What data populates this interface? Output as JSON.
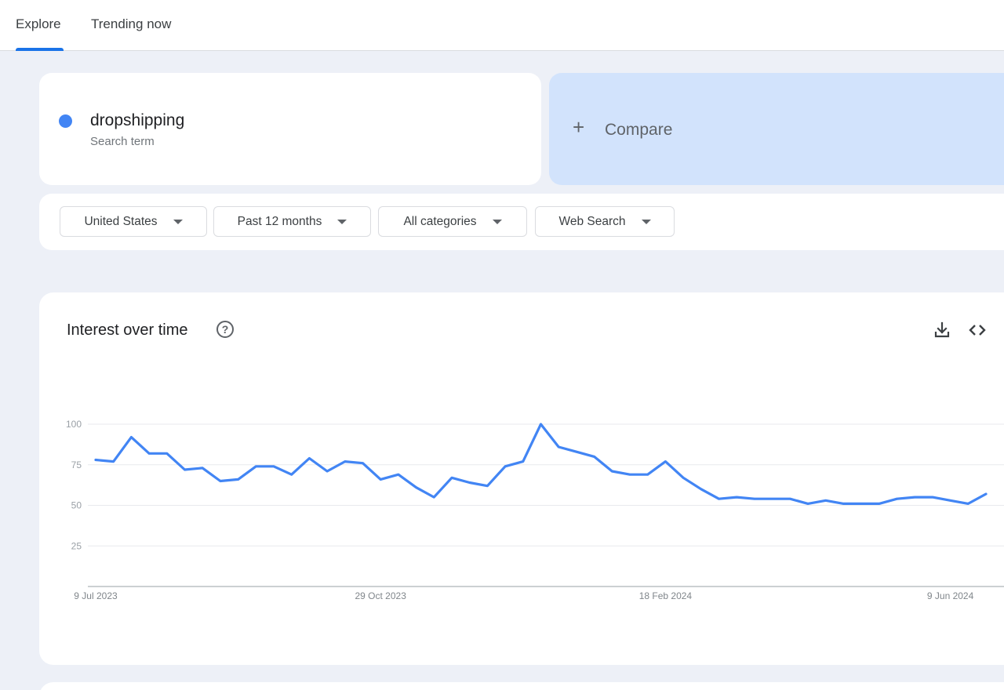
{
  "nav": {
    "tabs": [
      {
        "label": "Explore",
        "active": true
      },
      {
        "label": "Trending now",
        "active": false
      }
    ]
  },
  "search_term": {
    "name": "dropshipping",
    "type_label": "Search term",
    "color": "#4285f4"
  },
  "compare": {
    "label": "Compare",
    "icon": "plus-icon"
  },
  "filters": {
    "region": "United States",
    "time_range": "Past 12 months",
    "category": "All categories",
    "search_type": "Web Search"
  },
  "chart_card": {
    "title": "Interest over time",
    "icons": [
      "help-icon",
      "download-icon",
      "embed-code-icon"
    ]
  },
  "chart_data": {
    "type": "line",
    "title": "Interest over time",
    "xlabel": "",
    "ylabel": "",
    "ylim": [
      0,
      100
    ],
    "y_ticks": [
      25,
      50,
      75,
      100
    ],
    "x_tick_labels": [
      "9 Jul 2023",
      "29 Oct 2023",
      "18 Feb 2024",
      "9 Jun 2024"
    ],
    "grid": true,
    "series": [
      {
        "name": "dropshipping",
        "color": "#4285f4",
        "x": [
          "2023-07-09",
          "2023-07-16",
          "2023-07-23",
          "2023-07-30",
          "2023-08-06",
          "2023-08-13",
          "2023-08-20",
          "2023-08-27",
          "2023-09-03",
          "2023-09-10",
          "2023-09-17",
          "2023-09-24",
          "2023-10-01",
          "2023-10-08",
          "2023-10-15",
          "2023-10-22",
          "2023-10-29",
          "2023-11-05",
          "2023-11-12",
          "2023-11-19",
          "2023-11-26",
          "2023-12-03",
          "2023-12-10",
          "2023-12-17",
          "2023-12-24",
          "2023-12-31",
          "2024-01-07",
          "2024-01-14",
          "2024-01-21",
          "2024-01-28",
          "2024-02-04",
          "2024-02-11",
          "2024-02-18",
          "2024-02-25",
          "2024-03-03",
          "2024-03-10",
          "2024-03-17",
          "2024-03-24",
          "2024-03-31",
          "2024-04-07",
          "2024-04-14",
          "2024-04-21",
          "2024-04-28",
          "2024-05-05",
          "2024-05-12",
          "2024-05-19",
          "2024-05-26",
          "2024-06-02",
          "2024-06-09",
          "2024-06-16",
          "2024-06-23"
        ],
        "values": [
          78,
          77,
          92,
          82,
          82,
          72,
          73,
          65,
          66,
          74,
          74,
          69,
          79,
          71,
          77,
          76,
          66,
          69,
          61,
          55,
          67,
          64,
          62,
          74,
          77,
          100,
          86,
          83,
          80,
          71,
          69,
          69,
          77,
          67,
          60,
          54,
          55,
          54,
          54,
          54,
          51,
          53,
          51,
          51,
          51,
          54,
          55,
          55,
          53,
          51,
          57
        ]
      }
    ]
  }
}
